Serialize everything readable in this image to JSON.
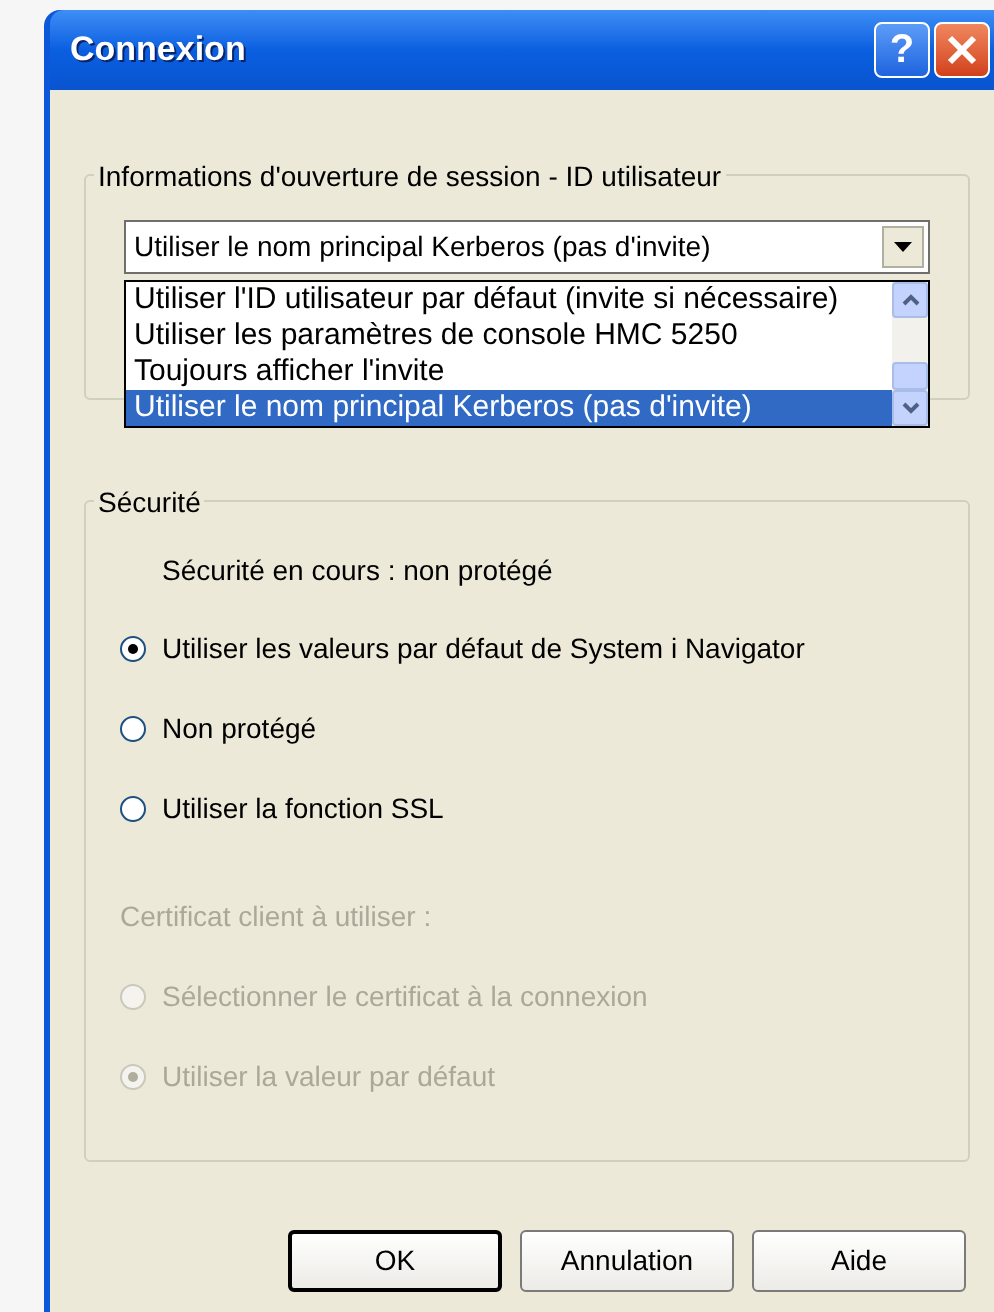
{
  "window": {
    "title": "Connexion",
    "help_button": "?"
  },
  "logon": {
    "label": "Informations d'ouverture de session - ID utilisateur",
    "value": "Utiliser le nom principal Kerberos (pas d'invite)",
    "expanded": true,
    "options": [
      {
        "label": "Utiliser l'ID utilisateur par défaut (invite si nécessaire)",
        "selected": false
      },
      {
        "label": "Utiliser les paramètres de console HMC 5250",
        "selected": false
      },
      {
        "label": "Toujours afficher l'invite",
        "selected": false
      },
      {
        "label": "Utiliser le nom principal Kerberos (pas d'invite)",
        "selected": true
      }
    ]
  },
  "security": {
    "label": "Sécurité",
    "status": "Sécurité en cours : non protégé",
    "options": [
      {
        "label": "Utiliser les valeurs par défaut de System i Navigator",
        "selected": true,
        "disabled": false
      },
      {
        "label": "Non protégé",
        "selected": false,
        "disabled": false
      },
      {
        "label": "Utiliser la fonction SSL",
        "selected": false,
        "disabled": false
      }
    ],
    "certificate_label": "Certificat client à utiliser :",
    "certificate_disabled": true,
    "certificate_options": [
      {
        "label": "Sélectionner le certificat à la connexion",
        "selected": false,
        "disabled": true
      },
      {
        "label": "Utiliser la valeur par défaut",
        "selected": true,
        "disabled": true
      }
    ]
  },
  "buttons": [
    {
      "label": "OK",
      "default": true
    },
    {
      "label": "Annulation",
      "default": false
    },
    {
      "label": "Aide",
      "default": false
    }
  ]
}
